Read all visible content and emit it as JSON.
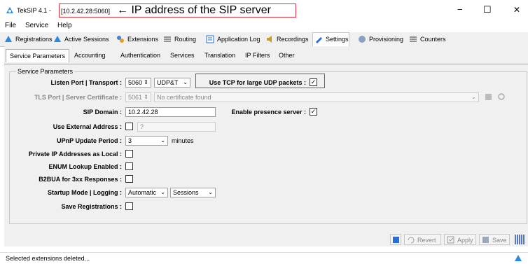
{
  "window": {
    "title": "TekSIP 4.1 - ",
    "address": "[10.2.42.28:5060]",
    "annotation": "← IP address of the SIP server",
    "controls": {
      "minimize": "−",
      "maximize": "☐",
      "close": "✕"
    }
  },
  "menu": [
    "File",
    "Service",
    "Help"
  ],
  "tabs": [
    "Registrations",
    "Active Sessions",
    "Extensions",
    "Routing",
    "Application Log",
    "Recordings",
    "Settings",
    "Provisioning",
    "Counters"
  ],
  "subtabs": [
    "Service Parameters",
    "Accounting",
    "Authentication",
    "Services",
    "Translation",
    "IP Filters",
    "Other"
  ],
  "group_title": "Service Parameters",
  "form": {
    "listen_port_label": "Listen Port | Transport :",
    "listen_port_value": "5060",
    "transport_value": "UDP&T",
    "tcp_large_label": "Use TCP for large UDP packets :",
    "tcp_large_checked": "✓",
    "tls_label": "TLS Port | Server Certificate :",
    "tls_port_value": "5061",
    "certificate_value": "No certificate found",
    "sip_domain_label": "SIP Domain :",
    "sip_domain_value": "10.2.42.28",
    "presence_label": "Enable presence server :",
    "presence_checked": "✓",
    "external_label": "Use External Address :",
    "external_placeholder": "?",
    "upnp_label": "UPnP Update Period :",
    "upnp_value": "3",
    "upnp_unit": "minutes",
    "private_ip_label": "Private IP Addresses as Local :",
    "enum_label": "ENUM Lookup Enabled :",
    "b2bua_label": "B2BUA for 3xx Responses :",
    "startup_label": "Startup Mode | Logging :",
    "startup_value": "Automatic",
    "logging_value": "Sessions",
    "save_reg_label": "Save Registrations :"
  },
  "buttons": {
    "revert": "Revert",
    "apply": "Apply",
    "save": "Save"
  },
  "status": "Selected extensions deleted...",
  "colors": {
    "annotation_border": "#d9303a",
    "accent": "#2a6fd6"
  }
}
